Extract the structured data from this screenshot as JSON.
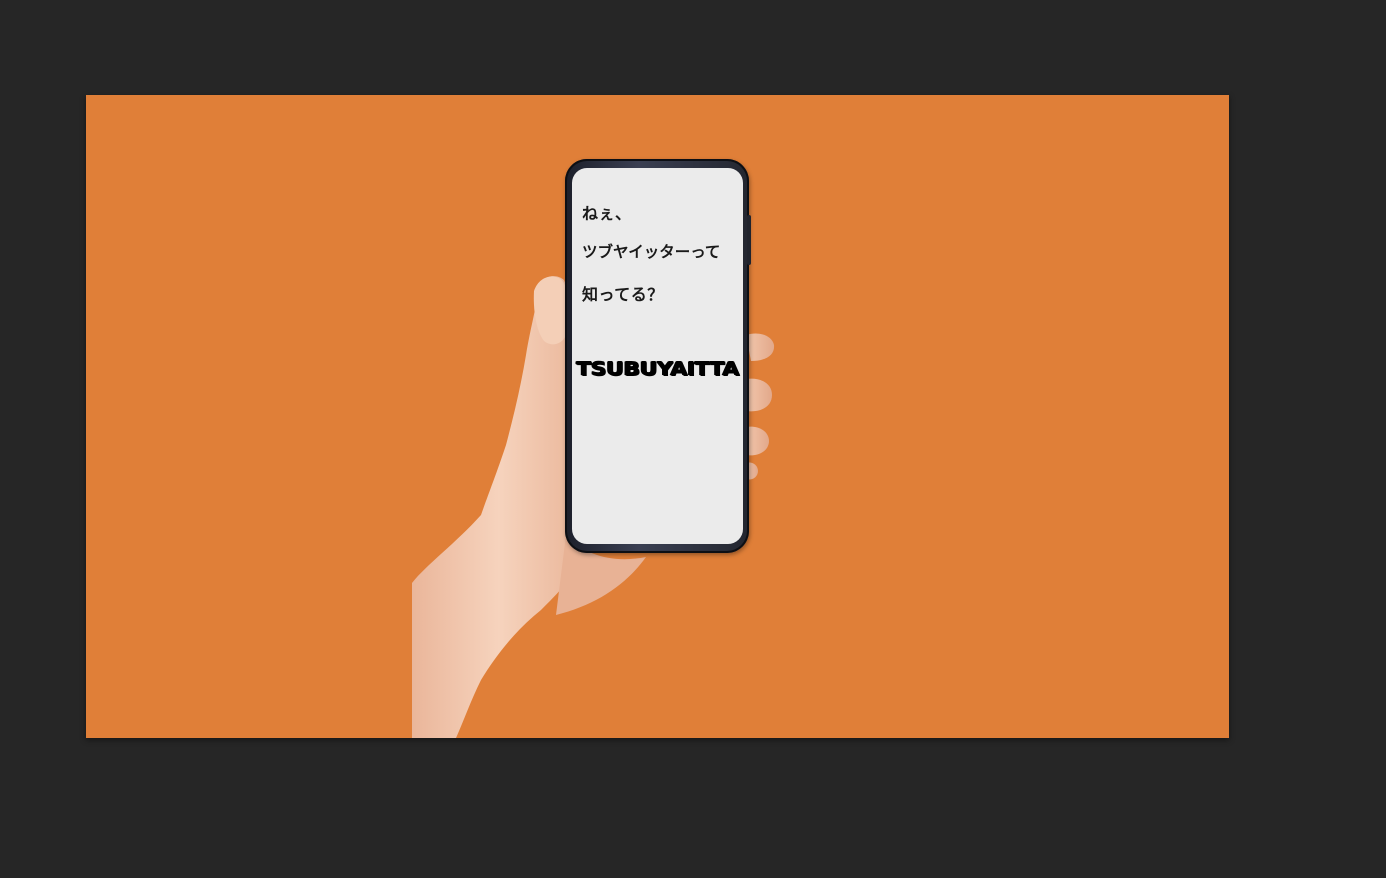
{
  "screen_text": {
    "line1": "ねぇ、",
    "line2": "ツブヤイッターって",
    "line3": "知ってる？",
    "logo": "TSUBUYAITTA"
  },
  "colors": {
    "workspace_bg": "#262626",
    "canvas_bg": "#e07f38",
    "phone_screen": "#ebebeb",
    "skin": "#f2c6aa"
  },
  "icons": [
    "hand-holding-phone-image"
  ]
}
